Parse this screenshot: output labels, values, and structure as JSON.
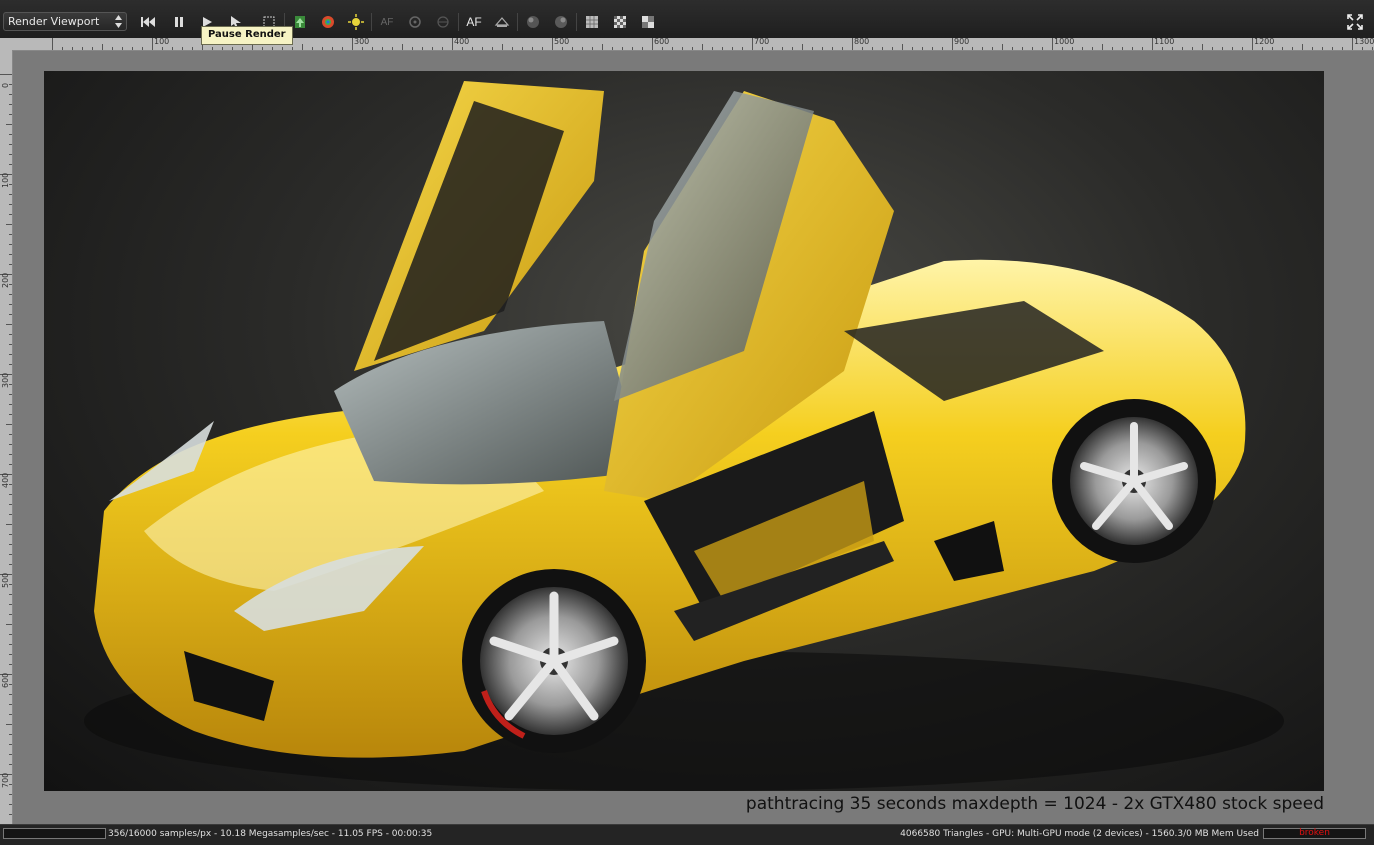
{
  "toolbar": {
    "viewport_select": "Render Viewport",
    "af_label": "AF",
    "af_dim_label": "AF",
    "buttons": [
      {
        "icon": "skip-back-icon"
      },
      {
        "icon": "pause-icon"
      },
      {
        "icon": "play-icon"
      },
      {
        "icon": "region-select-icon"
      },
      {
        "icon": "fit-view-icon"
      },
      {
        "icon": "import-icon"
      },
      {
        "icon": "color-picker-icon"
      },
      {
        "icon": "light-icon"
      },
      {
        "icon": "af-dim-icon"
      },
      {
        "icon": "focus-icon"
      },
      {
        "icon": "focus-dim-icon"
      },
      {
        "icon": "af-icon"
      },
      {
        "icon": "camera-icon"
      },
      {
        "icon": "sphere-icon"
      },
      {
        "icon": "sphere2-icon"
      },
      {
        "icon": "grid-icon"
      },
      {
        "icon": "checker-icon"
      },
      {
        "icon": "alpha-icon"
      },
      {
        "icon": "fullscreen-icon"
      }
    ],
    "tooltip": "Pause Render"
  },
  "ruler": {
    "top_labels": [
      "100",
      "200",
      "300",
      "400",
      "500",
      "600",
      "700",
      "800",
      "900",
      "1000",
      "1100",
      "1200",
      "1300"
    ],
    "left_labels": [
      "0",
      "100",
      "200",
      "300",
      "400",
      "500",
      "600",
      "700"
    ]
  },
  "render": {
    "caption": "pathtracing 35 seconds maxdepth = 1024 - 2x GTX480 stock speed",
    "body_color": "#f2c200",
    "background_color": "#1a1a1a"
  },
  "status": {
    "progress_fraction": 0.0,
    "left_text": "356/16000 samples/px - 10.18 Megasamples/sec - 11.05 FPS - 00:00:35",
    "right_text": "4066580 Triangles - GPU: Multi-GPU mode (2 devices) - 1560.3/0 MB Mem Used",
    "badge": "broken"
  }
}
